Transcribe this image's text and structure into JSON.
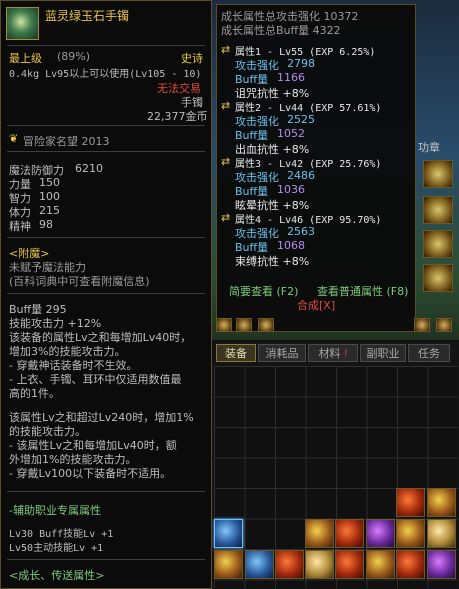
{
  "left_tooltip": {
    "item_name": "蓝灵绿玉石手镯",
    "grade": "最上级",
    "grade_pct": "(89%)",
    "rarity": "史诗",
    "weight_req": "0.4kg  Lv95以上可以使用(Lv105 - 10)",
    "trade": "无法交易",
    "slot": "手镯",
    "price": "22,377金币",
    "fame": "冒险家名望 2013",
    "stats": [
      {
        "label": "魔法防御力",
        "value": "6210"
      },
      {
        "label": "力量",
        "value": "150"
      },
      {
        "label": "智力",
        "value": "100"
      },
      {
        "label": "体力",
        "value": "215"
      },
      {
        "label": "精神",
        "value": "98"
      }
    ],
    "enchant_title": "<附魔>",
    "enchant_none": "未赋予魔法能力",
    "enchant_hint": "(百科词典中可查看附魔信息)",
    "effect_lines": [
      "Buff量 295",
      "技能攻击力 +12%",
      "该装备的属性Lv之和每增加Lv40时，",
      "增加3%的技能攻击力。",
      "- 穿戴神话装备时不生效。",
      "- 上衣、手镯、耳环中仅适用数值最",
      "高的1件。",
      "",
      "该属性Lv之和超过Lv240时，增加1%",
      "的技能攻击力。",
      "- 该属性Lv之和每增加Lv40时，额",
      "外增加1%的技能攻击力。",
      "- 穿戴Lv100以下装备时不适用。"
    ],
    "assist_title": "-辅助职业专属属性",
    "assist_lines": [
      "Lv30 Buff技能Lv +1",
      "Lv50主动技能Lv +1"
    ],
    "growth_link": "<成长、传送属性>"
  },
  "right_tooltip": {
    "total_attack": "成长属性总攻击强化 10372",
    "total_buff": "成长属性总Buff量 4322",
    "attributes": [
      {
        "header": "属性1 - Lv55 (EXP 6.25%)",
        "attack": "2798",
        "buff": "1166",
        "extra": "诅咒抗性 +8%"
      },
      {
        "header": "属性2 - Lv44 (EXP 57.61%)",
        "attack": "2525",
        "buff": "1052",
        "extra": "出血抗性 +8%"
      },
      {
        "header": "属性3 - Lv42 (EXP 25.76%)",
        "attack": "2486",
        "buff": "1036",
        "extra": "眩晕抗性 +8%"
      },
      {
        "header": "属性4 - Lv46 (EXP 95.70%)",
        "attack": "2563",
        "buff": "1068",
        "extra": "束缚抗性 +8%"
      }
    ],
    "attack_label": "攻击强化",
    "buff_label": "Buff量",
    "brief_view": "简要查看 (F2)",
    "normal_view": "查看普通属性 (F8)",
    "combine": "合成[X]"
  },
  "background": {
    "button_label": "功章"
  },
  "inventory": {
    "tabs": [
      "装备",
      "消耗品",
      "材料",
      "副职业",
      "任务"
    ],
    "notify_badge": "!"
  },
  "colors": {
    "gold": "#e8c64a",
    "epic": "#e8c64a",
    "red": "#e04a3a",
    "cyan": "#6cc0e8",
    "purple": "#b48ee8",
    "green_link": "#7ec87e",
    "gray": "#9a9a9a"
  }
}
